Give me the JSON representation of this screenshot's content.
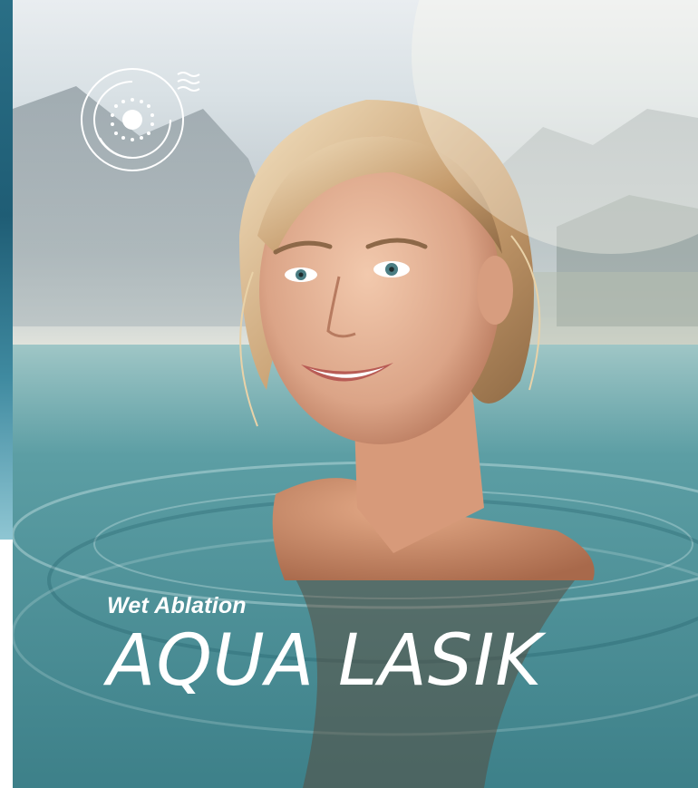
{
  "hero": {
    "subtitle": "Wet Ablation",
    "title": "AQUA LASIK",
    "image_alt": "Smiling woman in water with mountains behind",
    "logo_icon": "eye-waves-logo-icon"
  },
  "colors": {
    "text": "#ffffff",
    "water": "#4f939a",
    "sky": "#e9edf0"
  }
}
